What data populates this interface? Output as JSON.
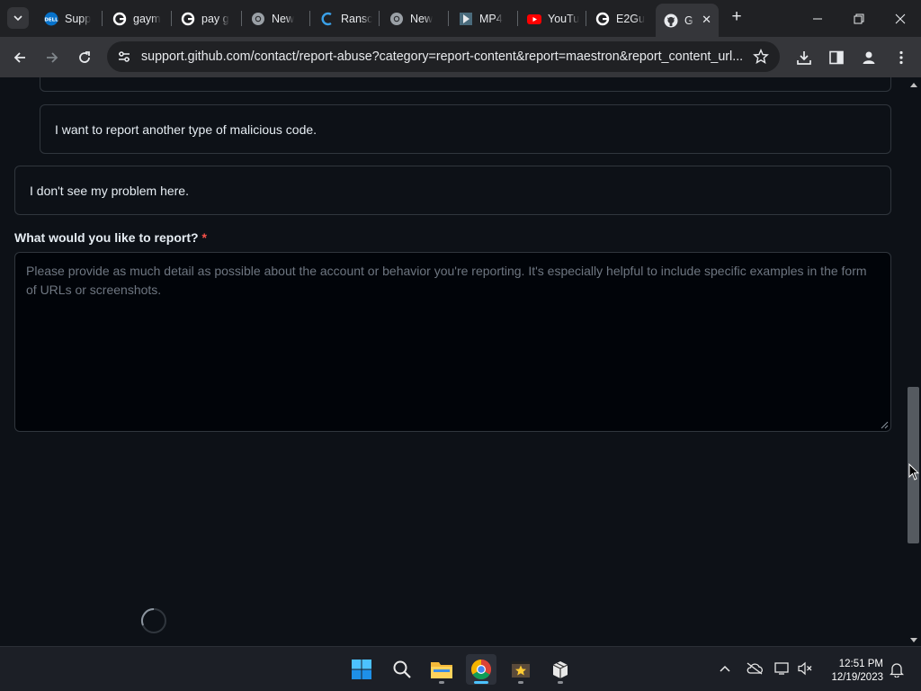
{
  "browser": {
    "tabs": [
      {
        "title": "Supp",
        "favicon": "dell-icon"
      },
      {
        "title": "gaym",
        "favicon": "google-icon"
      },
      {
        "title": "pay g",
        "favicon": "google-icon"
      },
      {
        "title": "New",
        "favicon": "chrome-icon"
      },
      {
        "title": "Ransc",
        "favicon": "ransom-icon"
      },
      {
        "title": "New",
        "favicon": "chrome-icon"
      },
      {
        "title": "MP4",
        "favicon": "mp4-icon"
      },
      {
        "title": "YouTu",
        "favicon": "youtube-icon"
      },
      {
        "title": "E2Gu",
        "favicon": "google-icon"
      },
      {
        "title": "G",
        "favicon": "github-icon",
        "active": true
      }
    ],
    "address": "support.github.com/contact/report-abuse?category=report-content&report=maestron&report_content_url..."
  },
  "page": {
    "options": {
      "malicious_code": "I want to report another type of malicious code.",
      "no_problem": "I don't see my problem here."
    },
    "report_field": {
      "label": "What would you like to report?",
      "required_mark": "*",
      "placeholder": "Please provide as much detail as possible about the account or behavior you're reporting. It's especially helpful to include specific examples in the form of URLs or screenshots."
    }
  },
  "taskbar": {
    "apps": [
      "start-icon",
      "search-icon",
      "file-explorer-icon",
      "chrome-icon",
      "movie-maker-icon",
      "package-icon"
    ],
    "time": "12:51 PM",
    "date": "12/19/2023"
  },
  "colors": {
    "page_bg": "#0d1117",
    "border": "#30363d",
    "text": "#e6edf3",
    "placeholder": "#6e7681",
    "required": "#f85149",
    "chrome_frame": "#202124",
    "chrome_toolbar": "#35363a"
  }
}
